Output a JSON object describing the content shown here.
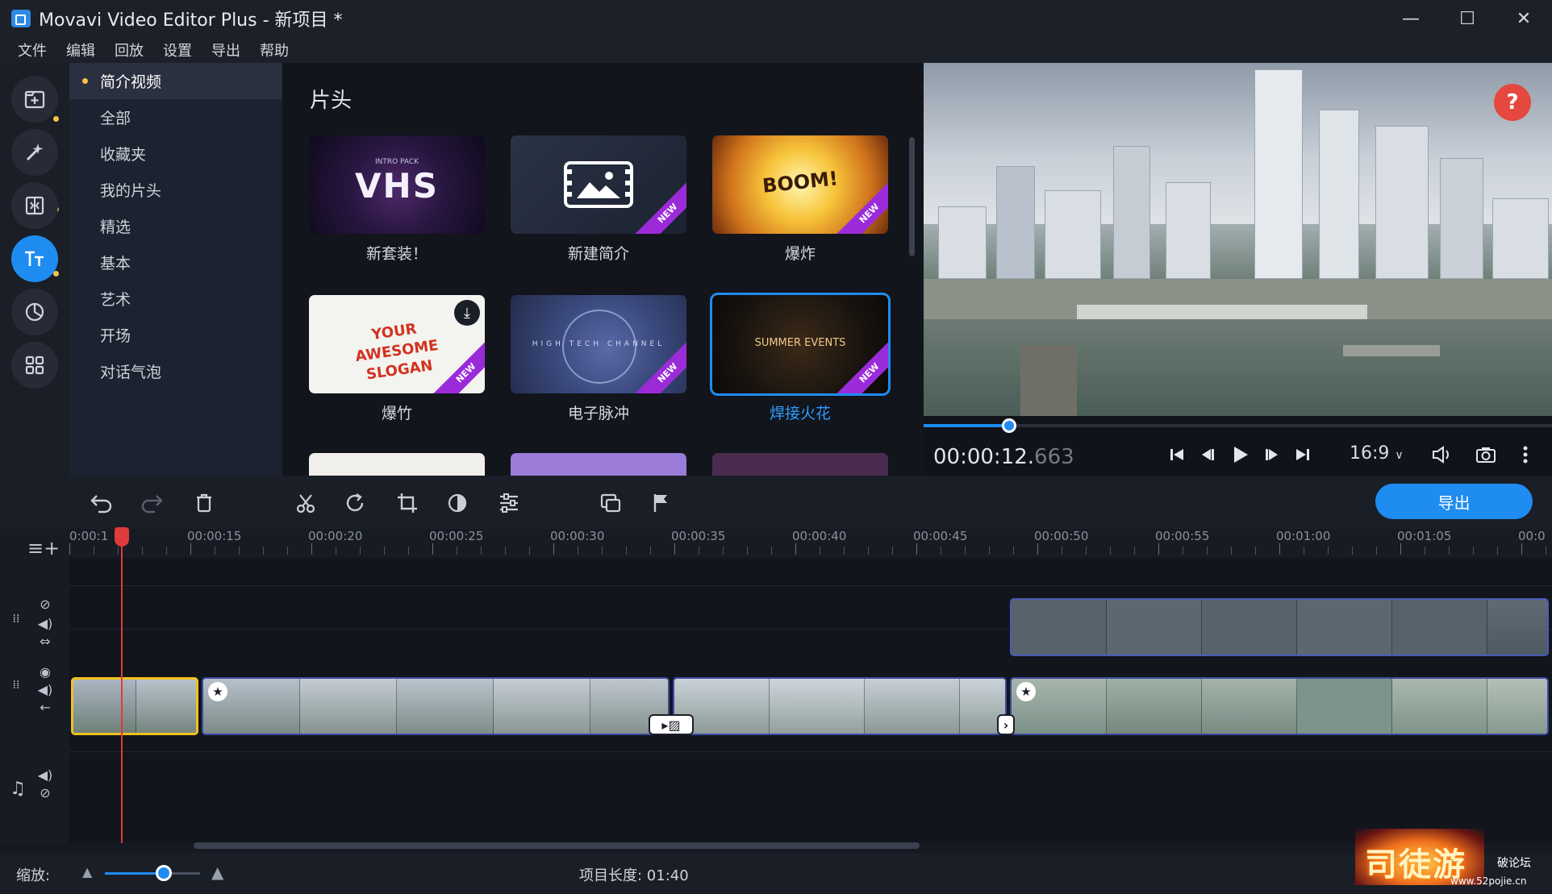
{
  "window": {
    "title": "Movavi Video Editor Plus - 新项目 *",
    "minimize": "—",
    "maximize": "☐",
    "close": "✕"
  },
  "menu": [
    "文件",
    "编辑",
    "回放",
    "设置",
    "导出",
    "帮助"
  ],
  "categories": {
    "items": [
      "简介视频",
      "全部",
      "收藏夹",
      "我的片头",
      "精选",
      "基本",
      "艺术",
      "开场",
      "对话气泡"
    ],
    "selected": "简介视频"
  },
  "content": {
    "title": "片头",
    "cards": [
      {
        "label": "新套装！",
        "thumb_text": "VHS",
        "thumb_caption": "INTRO PACK",
        "is_new": false
      },
      {
        "label": "新建简介",
        "thumb_text": "",
        "is_new": true
      },
      {
        "label": "爆炸",
        "thumb_text": "BOOM!",
        "is_new": true
      },
      {
        "label": "爆竹",
        "thumb_text": "YOUR AWESOME SLOGAN",
        "is_new": true,
        "has_download": true
      },
      {
        "label": "电子脉冲",
        "thumb_text": "HIGH TECH CHANNEL",
        "is_new": true
      },
      {
        "label": "焊接火花",
        "thumb_text": "SUMMER EVENTS",
        "is_new": true,
        "selected": true
      }
    ],
    "new_badge": "NEW"
  },
  "preview": {
    "help": "?",
    "timecode_main": "00:00:12.",
    "timecode_ms": "663",
    "aspect_ratio": "16:9",
    "progress_fraction": 0.136,
    "icons": [
      "skip-start-icon",
      "frame-back-icon",
      "play-icon",
      "frame-forward-icon",
      "skip-end-icon",
      "volume-icon",
      "camera-icon",
      "more-icon"
    ]
  },
  "toolbar": {
    "export_label": "导出",
    "icons": [
      "undo-icon",
      "redo-icon",
      "delete-icon",
      "cut-icon",
      "rotate-icon",
      "crop-icon",
      "color-adjust-icon",
      "settings-sliders-icon",
      "overlay-icon",
      "marker-flag-icon"
    ]
  },
  "ruler": {
    "labels": [
      "0:00:1",
      "00:00:15",
      "00:00:20",
      "00:00:25",
      "00:00:30",
      "00:00:35",
      "00:00:40",
      "00:00:45",
      "00:00:50",
      "00:00:55",
      "00:01:00",
      "00:01:05",
      "00:0"
    ]
  },
  "status": {
    "zoom_label": "缩放:",
    "zoom_fraction": 0.62,
    "project_length": "项目长度: 01:40"
  },
  "watermark": {
    "text": "司徒游",
    "sub": "破论坛",
    "url": "www.52pojie.cn"
  },
  "colors": {
    "accent": "#1e8cf0",
    "selection": "#f0c21f",
    "playhead": "#e03b3b",
    "new_badge": "#9b2bd9"
  }
}
